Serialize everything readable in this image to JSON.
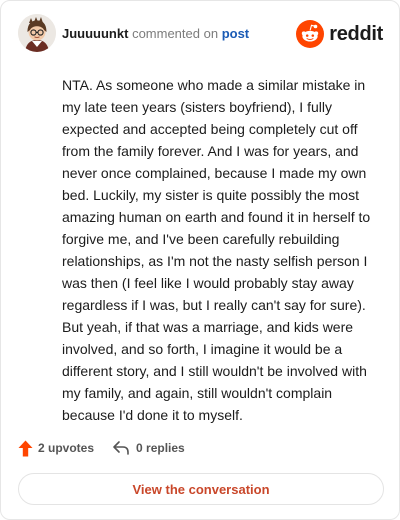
{
  "header": {
    "username": "Juuuuunkt",
    "commented_text": "commented on",
    "post_link": "post",
    "brand_name": "reddit",
    "brand_color": "#ff4500",
    "avatar_icon": "avatar-icon",
    "brand_icon": "reddit-logo-icon"
  },
  "comment": {
    "body": "NTA. As someone who made a similar mistake in my late teen years (sisters boyfriend), I fully expected and accepted being completely cut off from the family forever. And I was for years, and never once complained, because I made my own bed. Luckily, my sister is quite possibly the most amazing human on earth and found it in herself to forgive me, and I've been carefully rebuilding relationships, as I'm not the nasty selfish person I was then (I feel like I would probably stay away regardless if I was, but I really can't say for sure). But yeah, if that was a marriage, and kids were involved, and so forth, I imagine it would be a different story, and I still wouldn't be involved with my family, and again, still wouldn't complain because I'd done it to myself."
  },
  "actions": {
    "upvotes": "2 upvotes",
    "replies": "0 replies",
    "upvote_icon": "upvote-arrow-icon",
    "reply_icon": "reply-arrow-icon",
    "upvote_color": "#ff4500"
  },
  "footer": {
    "button_label": "View the conversation",
    "button_color": "#c9472a"
  }
}
